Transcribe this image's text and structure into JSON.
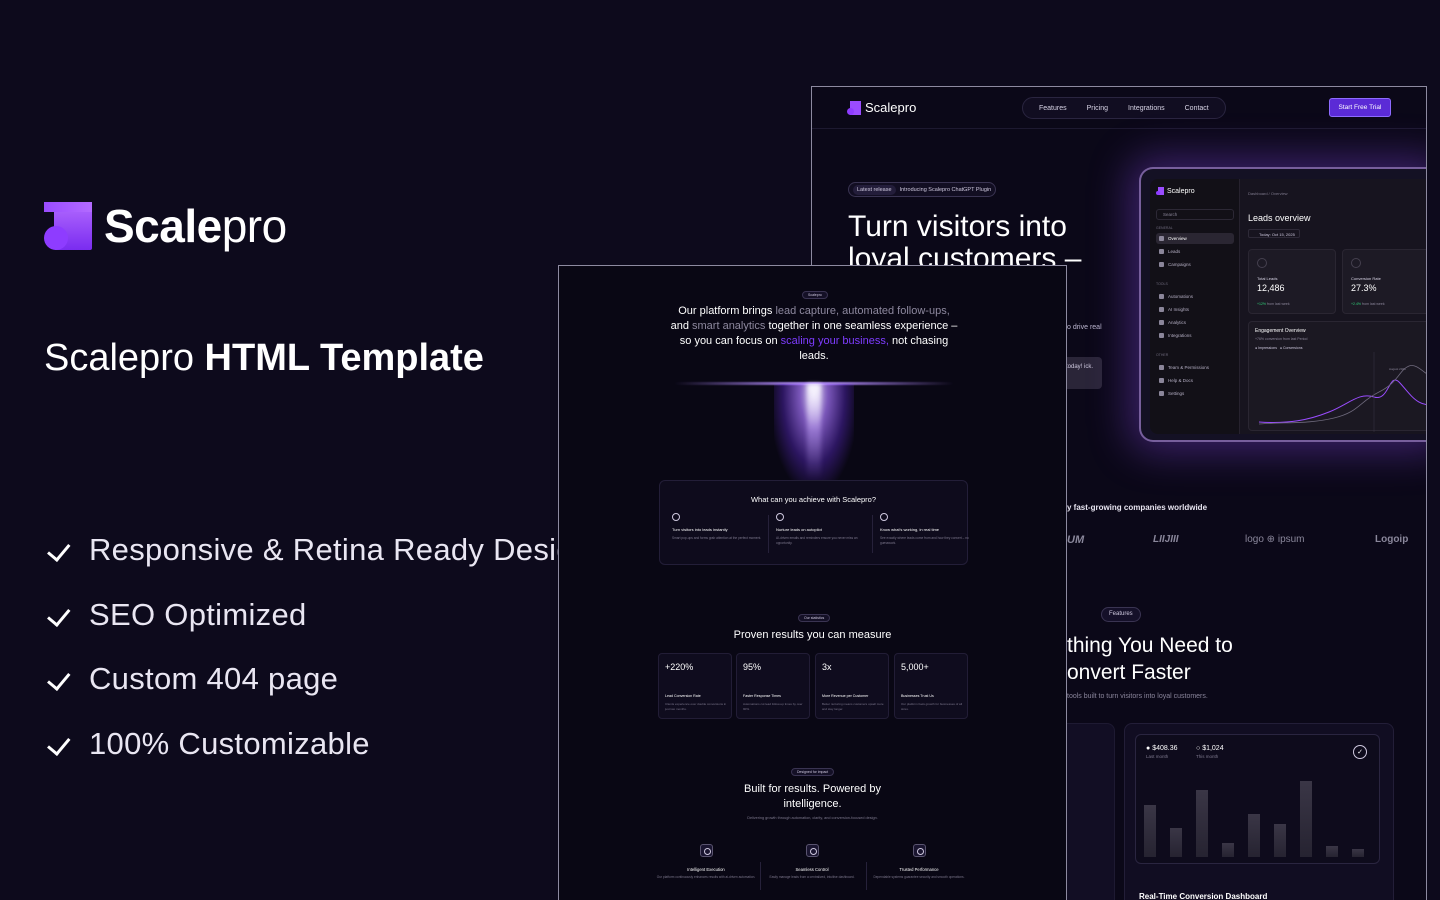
{
  "promo": {
    "brand_bold": "Scale",
    "brand_light": "pro",
    "template_title_light": "Scalepro",
    "template_title_bold": "HTML Template",
    "features": [
      "Responsive & Retina Ready Design",
      "SEO Optimized",
      "Custom 404 page",
      "100% Customizable"
    ]
  },
  "back_screen": {
    "brand": "Scalepro",
    "nav": [
      "Features",
      "Pricing",
      "Integrations",
      "Contact"
    ],
    "cta": "Start Free Trial",
    "badge_label": "Latest release",
    "badge_text": "Introducing Scalepro ChatGPT Plugin",
    "headline_line1": "Turn visitors into",
    "headline_line2": "loyal customers –",
    "fragment_text": "o drive real",
    "fragment_button": "today! ick.",
    "dashboard": {
      "brand": "Scalepro",
      "search": "Search",
      "section_general": "GENERAL",
      "section_tools": "TOOLS",
      "section_other": "OTHER",
      "items_general": [
        "Overview",
        "Leads",
        "Campaigns"
      ],
      "items_tools": [
        "Automations",
        "AI Insights",
        "Analytics",
        "Integrations"
      ],
      "items_other": [
        "Team & Permissions",
        "Help & Docs",
        "Settings"
      ],
      "breadcrumb": "Dashboard / Overview",
      "title": "Leads overview",
      "date": "Today: Oct 15, 2025",
      "cards": [
        {
          "label": "Total Leads",
          "value": "12,486",
          "change": "+12%",
          "change_note": "from last week"
        },
        {
          "label": "Conversion Rate",
          "value": "27.3%",
          "change": "+2.4%",
          "change_note": "from last week"
        }
      ],
      "engagement_title": "Engagement Overview",
      "engagement_sub": "+76% conversion from last Period",
      "legend_1": "Impressions",
      "legend_2": "Conversions",
      "tooltip": "August 2025"
    },
    "trusted": "y fast-growing companies worldwide",
    "logos": [
      "UM",
      "LIIJIII",
      "logo ⊕ ipsum",
      "Logoip"
    ],
    "features_badge": "Features",
    "features_h2_line1": "thing You Need to",
    "features_h2_line2": "onvert Faster",
    "features_sub": "tools built to turn visitors into loyal customers.",
    "stat_1_value": "$408.36",
    "stat_1_label": "Last month",
    "stat_2_value": "$1,024",
    "stat_2_label": "This month",
    "check_glyph": "✓",
    "card_title": "Real-Time Conversion Dashboard",
    "bars": [
      0.55,
      0.3,
      0.7,
      0.15,
      0.45,
      0.35,
      0.8,
      0.12,
      0.08
    ]
  },
  "front_screen": {
    "pill_top": "Scalepro",
    "para_1": "Our platform brings",
    "para_2": "lead capture,",
    "para_3": "automated",
    "para_4": "follow-ups,",
    "para_5": "and",
    "para_6": "smart analytics",
    "para_7": "together in one seamless experience – so you can focus on",
    "para_8": "scaling your business,",
    "para_9": "not chasing leads.",
    "achieve_title": "What can you achieve with Scalepro?",
    "achieve": [
      {
        "title": "Turn visitors into leads instantly",
        "desc": "Smart pop-ups and forms grab attention at the perfect moment."
      },
      {
        "title": "Nurture leads on autopilot",
        "desc": "AI-driven emails and reminders ensure you never miss an opportunity."
      },
      {
        "title": "Know what's working, in real time",
        "desc": "See exactly where leads come from and how they convert – no guesswork."
      }
    ],
    "stats_pill": "Our statistics",
    "stats_title": "Proven results you can measure",
    "stats": [
      {
        "value": "+220%",
        "label": "Lead Conversion Rate",
        "desc": "Clients experience over double conversions in just two months."
      },
      {
        "value": "95%",
        "label": "Faster Response Times",
        "desc": "Automations cut lead follow-up times by over 90%."
      },
      {
        "value": "3x",
        "label": "More Revenue per Customer",
        "desc": "Better nurturing means customers upsell more and stay longer."
      },
      {
        "value": "5,000+",
        "label": "Businesses Trust Us",
        "desc": "Our platform fuels growth for businesses of all sizes."
      }
    ],
    "impact_pill": "Designed for impact",
    "impact_title_1": "Built for results. Powered by",
    "impact_title_2": "intelligence.",
    "impact_sub": "Delivering growth through automation, clarity, and conversion-focused design.",
    "impact": [
      {
        "title": "Intelligent Execution",
        "desc": "Our platform continuously enhances results with ai-driven automation."
      },
      {
        "title": "Seamless Control",
        "desc": "Easily manage leads from a centralized, intuitive dashboard."
      },
      {
        "title": "Trusted Performance",
        "desc": "Dependable systems guarantee security and smooth operations."
      }
    ]
  },
  "colors": {
    "background": "#0d0a1c",
    "accent": "#7e3cff",
    "cta": "#5b2bd6",
    "positive": "#2fd27a"
  }
}
